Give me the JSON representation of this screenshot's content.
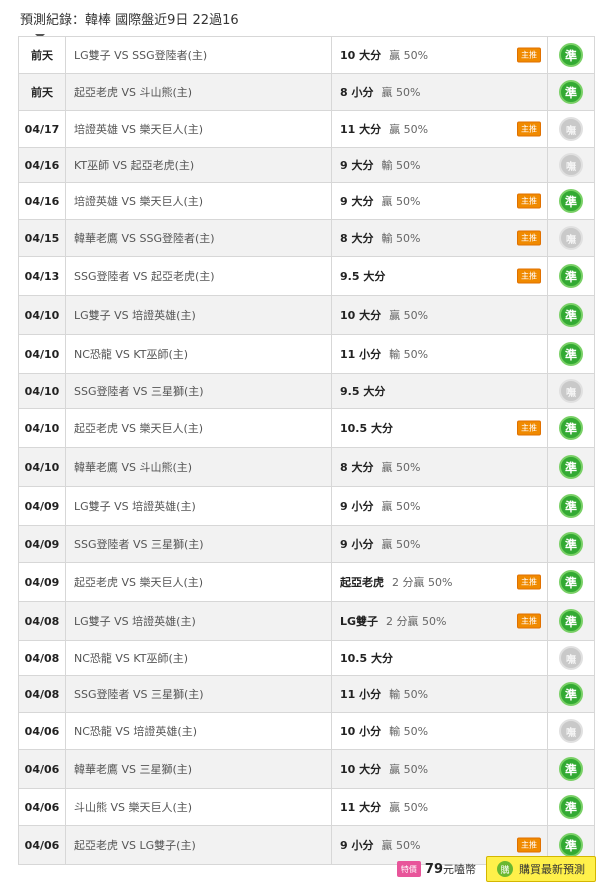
{
  "header": {
    "title": "預測紀錄：韓棒 國際盤近9日 22過16"
  },
  "status_labels": {
    "ok": "準",
    "pending": "嘸"
  },
  "badge_label": "主推",
  "rows": [
    {
      "date": "前天",
      "match": "LG雙子 VS SSG登陸者(主)",
      "pick": "10 大分",
      "result": "贏 50%",
      "badge": true,
      "status": "ok"
    },
    {
      "date": "前天",
      "match": "起亞老虎 VS 斗山熊(主)",
      "pick": "8 小分",
      "result": "贏 50%",
      "badge": false,
      "status": "ok"
    },
    {
      "date": "04/17",
      "match": "培證英雄 VS 樂天巨人(主)",
      "pick": "11 大分",
      "result": "贏 50%",
      "badge": true,
      "status": "pending"
    },
    {
      "date": "04/16",
      "match": "KT巫師 VS 起亞老虎(主)",
      "pick": "9 大分",
      "result": "輸 50%",
      "badge": false,
      "status": "pending"
    },
    {
      "date": "04/16",
      "match": "培證英雄 VS 樂天巨人(主)",
      "pick": "9 大分",
      "result": "贏 50%",
      "badge": true,
      "status": "ok"
    },
    {
      "date": "04/15",
      "match": "韓華老鷹 VS SSG登陸者(主)",
      "pick": "8 大分",
      "result": "輸 50%",
      "badge": true,
      "status": "pending"
    },
    {
      "date": "04/13",
      "match": "SSG登陸者 VS 起亞老虎(主)",
      "pick": "9.5 大分",
      "result": "",
      "badge": true,
      "status": "ok"
    },
    {
      "date": "04/10",
      "match": "LG雙子 VS 培證英雄(主)",
      "pick": "10 大分",
      "result": "贏 50%",
      "badge": false,
      "status": "ok"
    },
    {
      "date": "04/10",
      "match": "NC恐龍 VS KT巫師(主)",
      "pick": "11 小分",
      "result": "輸 50%",
      "badge": false,
      "status": "ok"
    },
    {
      "date": "04/10",
      "match": "SSG登陸者 VS 三星獅(主)",
      "pick": "9.5 大分",
      "result": "",
      "badge": false,
      "status": "pending"
    },
    {
      "date": "04/10",
      "match": "起亞老虎 VS 樂天巨人(主)",
      "pick": "10.5 大分",
      "result": "",
      "badge": true,
      "status": "ok"
    },
    {
      "date": "04/10",
      "match": "韓華老鷹 VS 斗山熊(主)",
      "pick": "8 大分",
      "result": "贏 50%",
      "badge": false,
      "status": "ok"
    },
    {
      "date": "04/09",
      "match": "LG雙子 VS 培證英雄(主)",
      "pick": "9 小分",
      "result": "贏 50%",
      "badge": false,
      "status": "ok"
    },
    {
      "date": "04/09",
      "match": "SSG登陸者 VS 三星獅(主)",
      "pick": "9 小分",
      "result": "贏 50%",
      "badge": false,
      "status": "ok"
    },
    {
      "date": "04/09",
      "match": "起亞老虎 VS 樂天巨人(主)",
      "pick": "起亞老虎",
      "result": "2 分贏 50%",
      "badge": true,
      "status": "ok"
    },
    {
      "date": "04/08",
      "match": "LG雙子 VS 培證英雄(主)",
      "pick": "LG雙子",
      "result": "2 分贏 50%",
      "badge": true,
      "status": "ok"
    },
    {
      "date": "04/08",
      "match": "NC恐龍 VS KT巫師(主)",
      "pick": "10.5 大分",
      "result": "",
      "badge": false,
      "status": "pending"
    },
    {
      "date": "04/08",
      "match": "SSG登陸者 VS 三星獅(主)",
      "pick": "11 小分",
      "result": "輸 50%",
      "badge": false,
      "status": "ok"
    },
    {
      "date": "04/06",
      "match": "NC恐龍 VS 培證英雄(主)",
      "pick": "10 小分",
      "result": "輸 50%",
      "badge": false,
      "status": "pending"
    },
    {
      "date": "04/06",
      "match": "韓華老鷹 VS 三星獅(主)",
      "pick": "10 大分",
      "result": "贏 50%",
      "badge": false,
      "status": "ok"
    },
    {
      "date": "04/06",
      "match": "斗山熊 VS 樂天巨人(主)",
      "pick": "11 大分",
      "result": "贏 50%",
      "badge": false,
      "status": "ok"
    },
    {
      "date": "04/06",
      "match": "起亞老虎 VS LG雙子(主)",
      "pick": "9 小分",
      "result": "贏 50%",
      "badge": true,
      "status": "ok"
    }
  ],
  "footer": {
    "price_icon_label": "特價",
    "price": "79",
    "price_unit": "元嗑幣",
    "buy_icon_label": "購",
    "buy_label": "購買最新預測"
  },
  "colors": {
    "ok_green": "#33aa33",
    "pending_gray": "#c9c9c9",
    "badge_orange": "#f08a00",
    "buy_yellow": "#fff04a"
  }
}
